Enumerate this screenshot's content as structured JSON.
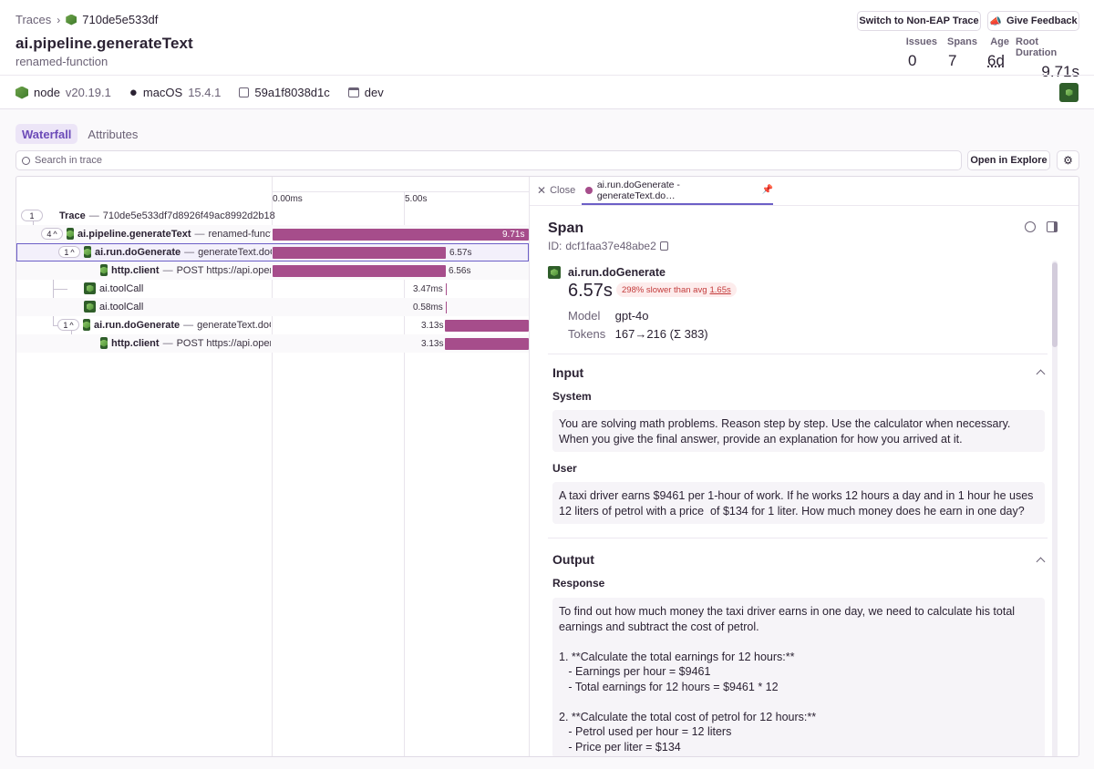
{
  "breadcrumb": {
    "root": "Traces",
    "trace_id_short": "710de5e533df"
  },
  "header": {
    "title": "ai.pipeline.generateText",
    "subtitle": "renamed-function",
    "switch_button": "Switch to Non-EAP Trace",
    "feedback_button": "Give Feedback",
    "stats": [
      {
        "label": "Issues",
        "value": "0"
      },
      {
        "label": "Spans",
        "value": "7"
      },
      {
        "label": "Age",
        "value": "6d"
      },
      {
        "label": "Root Duration",
        "value": "9.71s"
      }
    ]
  },
  "env": {
    "runtime": "node",
    "runtime_version": "v20.19.1",
    "os": "macOS",
    "os_version": "15.4.1",
    "release": "59a1f8038d1c",
    "environment": "dev"
  },
  "tabs": {
    "waterfall": "Waterfall",
    "attributes": "Attributes"
  },
  "search": {
    "placeholder": "Search in trace",
    "open_explore": "Open in Explore"
  },
  "timeline": {
    "tick0": "0.00ms",
    "tick1": "5.00s"
  },
  "tree": {
    "trace_count": "1",
    "trace_label": "Trace",
    "trace_id": "710de5e533df7d8926f49ac8992d2b18",
    "rows": [
      {
        "count": "4",
        "op": "ai.pipeline.generateText",
        "desc": "renamed-function",
        "duration": "9.71s"
      },
      {
        "count": "1",
        "op": "ai.run.doGenerate",
        "desc": "generateText.doGenerate",
        "duration": "6.57s"
      },
      {
        "op": "http.client",
        "desc": "POST https://api.openai.com",
        "duration": "6.56s"
      },
      {
        "op": "ai.toolCall",
        "duration": "3.47ms"
      },
      {
        "op": "ai.toolCall",
        "duration": "0.58ms"
      },
      {
        "count": "1",
        "op": "ai.run.doGenerate",
        "desc": "generateText.doGenerate",
        "duration": "3.13s"
      },
      {
        "op": "http.client",
        "desc": "POST https://api.openai.com",
        "duration": "3.13s"
      }
    ]
  },
  "drawer": {
    "close": "Close",
    "tab_title": "ai.run.doGenerate - generateText.do…",
    "heading": "Span",
    "id_label": "ID:",
    "id_value": "dcf1faa37e48abe2",
    "span_op": "ai.run.doGenerate",
    "duration": "6.57s",
    "slower": "298% slower than avg",
    "avg": "1.65s",
    "model_label": "Model",
    "model_value": "gpt-4o",
    "tokens_label": "Tokens",
    "tokens_in": "167",
    "tokens_out": "216 (Σ 383)",
    "input_title": "Input",
    "system_label": "System",
    "system_text": "You are solving math problems. Reason step by step. Use the calculator when necessary. When you give the final answer, provide an explanation for how you arrived at it.",
    "user_label": "User",
    "user_text": "A taxi driver earns $9461 per 1-hour of work. If he works 12 hours a day and in 1 hour he uses 12 liters of petrol with a price  of $134 for 1 liter. How much money does he earn in one day?",
    "output_title": "Output",
    "response_label": "Response",
    "response_text": "To find out how much money the taxi driver earns in one day, we need to calculate his total earnings and subtract the cost of petrol.\n\n1. **Calculate the total earnings for 12 hours:**\n   - Earnings per hour = $9461\n   - Total earnings for 12 hours = $9461 * 12\n\n2. **Calculate the total cost of petrol for 12 hours:**\n   - Petrol used per hour = 12 liters\n   - Price per liter = $134"
  }
}
